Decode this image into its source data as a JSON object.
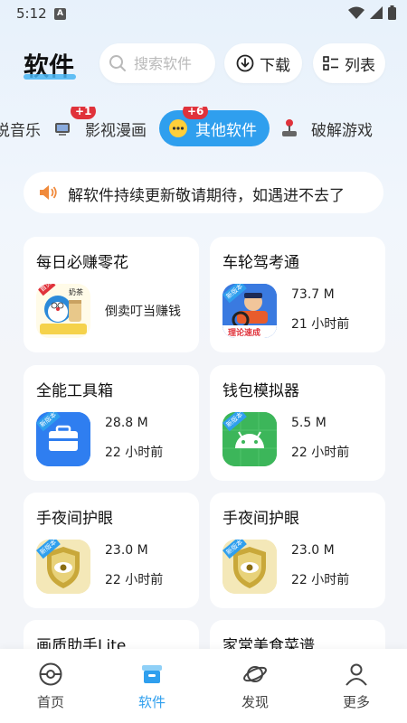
{
  "status_bar": {
    "time": "5:12",
    "a_icon": "A"
  },
  "header": {
    "title": "软件",
    "search_placeholder": "搜索软件",
    "download_label": "下载",
    "list_label": "列表"
  },
  "categories": [
    {
      "label": "说音乐",
      "icon": "music-icon"
    },
    {
      "label": "影视漫画",
      "icon": "tv-icon",
      "badge": "+1"
    },
    {
      "label": "其他软件",
      "icon": "chat-icon",
      "badge": "+6",
      "active": true
    },
    {
      "label": "破解游戏",
      "icon": "joystick-icon"
    }
  ],
  "notice": {
    "text": "在解软件持续更新敬请期待，如遇进不去了"
  },
  "apps": [
    {
      "name": "每日必赚零花",
      "desc": "倒卖叮当赚钱",
      "icon": "doraemon-icon"
    },
    {
      "name": "车轮驾考通",
      "size": "73.7 M",
      "time": "21 小时前",
      "icon": "driver-icon",
      "tag": "理论速成"
    },
    {
      "name": "全能工具箱",
      "size": "28.8 M",
      "time": "22 小时前",
      "icon": "toolbox-icon"
    },
    {
      "name": "钱包模拟器",
      "size": "5.5 M",
      "time": "22 小时前",
      "icon": "android-icon"
    },
    {
      "name": "手夜间护眼",
      "size": "23.0 M",
      "time": "22 小时前",
      "icon": "eye-shield-icon"
    },
    {
      "name": "手夜间护眼",
      "size": "23.0 M",
      "time": "22 小时前",
      "icon": "eye-shield-icon"
    },
    {
      "name": "画质助手Lite"
    },
    {
      "name": "家常美食菜谱"
    }
  ],
  "version_tag": "新版本",
  "doraemon_tag": "首页",
  "doraemon_caption": "奶茶",
  "bottom_nav": [
    {
      "label": "首页",
      "icon": "pokeball-icon"
    },
    {
      "label": "软件",
      "icon": "box-icon",
      "active": true
    },
    {
      "label": "发现",
      "icon": "planet-icon"
    },
    {
      "label": "更多",
      "icon": "person-icon"
    }
  ],
  "colors": {
    "accent": "#2f9fee",
    "badge": "#e0323b",
    "background": "#f1f6fc"
  }
}
